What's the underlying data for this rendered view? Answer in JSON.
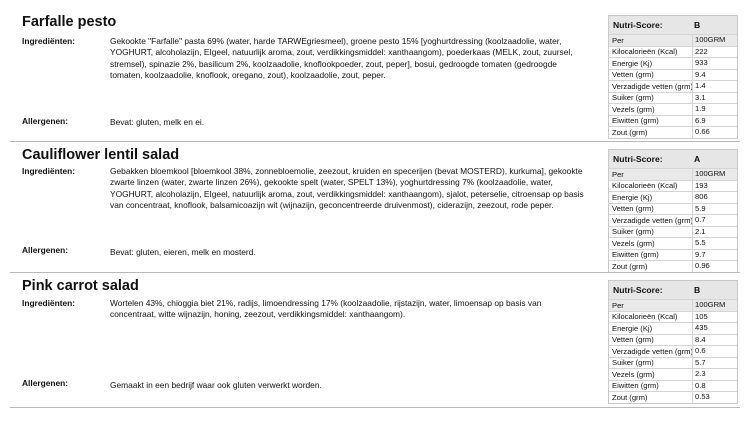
{
  "labels": {
    "ingredients": "Ingrediënten:",
    "allergens": "Allergenen:",
    "nutri_score": "Nutri-Score:"
  },
  "products": [
    {
      "name": "Farfalle pesto",
      "ingredients": "Gekookte \"Farfalle\" pasta 69% (water, harde TARWEgriesmeel), groene pesto 15% [yoghurtdressing (koolzaadolie, water, YOGHURT, alcoholazijn, EIgeel, natuurlijk aroma, zout, verdikkingsmiddel: xanthaangom), poederkaas (MELK, zout, zuursel, stremsel), spinazie 2%, basilicum 2%, koolzaadolie, knoflookpoeder, zout, peper], bosui, gedroogde tomaten (gedroogde tomaten, koolzaadolie, knoflook, oregano, zout), koolzaadolie, zout, peper.",
      "allergens": "Bevat: gluten, melk en ei.",
      "nutri_score": "B",
      "nutrition": [
        {
          "name": "Per",
          "value": "100GRM"
        },
        {
          "name": "Kilocalorieën (Kcal)",
          "value": "222"
        },
        {
          "name": "Energie (Kj)",
          "value": "933"
        },
        {
          "name": "Vetten (grm)",
          "value": "9.4"
        },
        {
          "name": "Verzadigde vetten (grm)",
          "value": "1.4"
        },
        {
          "name": "Suiker (grm)",
          "value": "3.1"
        },
        {
          "name": "Vezels (grm)",
          "value": "1.9"
        },
        {
          "name": "Eiwitten (grm)",
          "value": "6.9"
        },
        {
          "name": "Zout (grm)",
          "value": "0.66"
        }
      ]
    },
    {
      "name": "Cauliflower lentil salad",
      "ingredients": "Gebakken bloemkool [bloemkool 38%, zonnebloemolie, zeezout, kruiden en specerijen (bevat MOSTERD), kurkuma], gekookte zwarte linzen (water, zwarte linzen 26%), gekookte spelt (water, SPELT 13%), yoghurtdressing 7% (koolzaadolie, water, YOGHURT, alcoholazijn, EIgeel, natuurlijk aroma, zout, verdikkingsmiddel: xanthaangom), sjalot, peterselie, citroensap op basis van concentraat, knoflook, balsamicoazijn wit (wijnazijn, geconcentreerde druivenmost), ciderazijn, zeezout, rode peper.",
      "allergens": "Bevat: gluten, eieren, melk en mosterd.",
      "nutri_score": "A",
      "nutrition": [
        {
          "name": "Per",
          "value": "100GRM"
        },
        {
          "name": "Kilocalorieën (Kcal)",
          "value": "193"
        },
        {
          "name": "Energie (Kj)",
          "value": "806"
        },
        {
          "name": "Vetten (grm)",
          "value": "5.9"
        },
        {
          "name": "Verzadigde vetten (grm)",
          "value": "0.7"
        },
        {
          "name": "Suiker (grm)",
          "value": "2.1"
        },
        {
          "name": "Vezels (grm)",
          "value": "5.5"
        },
        {
          "name": "Eiwitten (grm)",
          "value": "9.7"
        },
        {
          "name": "Zout (grm)",
          "value": "0.96"
        }
      ]
    },
    {
      "name": "Pink carrot salad",
      "ingredients": "Wortelen 43%, chioggia biet 21%, radijs, limoendressing 17% (koolzaadolie, rijstazijn, water, limoensap op basis van concentraat, witte wijnazijn, honing, zeezout, verdikkingsmiddel: xanthaangom).",
      "allergens": "Gemaakt in een bedrijf waar ook gluten verwerkt worden.",
      "nutri_score": "B",
      "nutrition": [
        {
          "name": "Per",
          "value": "100GRM"
        },
        {
          "name": "Kilocalorieën (Kcal)",
          "value": "105"
        },
        {
          "name": "Energie (Kj)",
          "value": "435"
        },
        {
          "name": "Vetten (grm)",
          "value": "8.4"
        },
        {
          "name": "Verzadigde vetten (grm)",
          "value": "0.6"
        },
        {
          "name": "Suiker (grm)",
          "value": "5.7"
        },
        {
          "name": "Vezels (grm)",
          "value": "2.3"
        },
        {
          "name": "Eiwitten (grm)",
          "value": "0.8"
        },
        {
          "name": "Zout (grm)",
          "value": "0.53"
        }
      ]
    }
  ]
}
